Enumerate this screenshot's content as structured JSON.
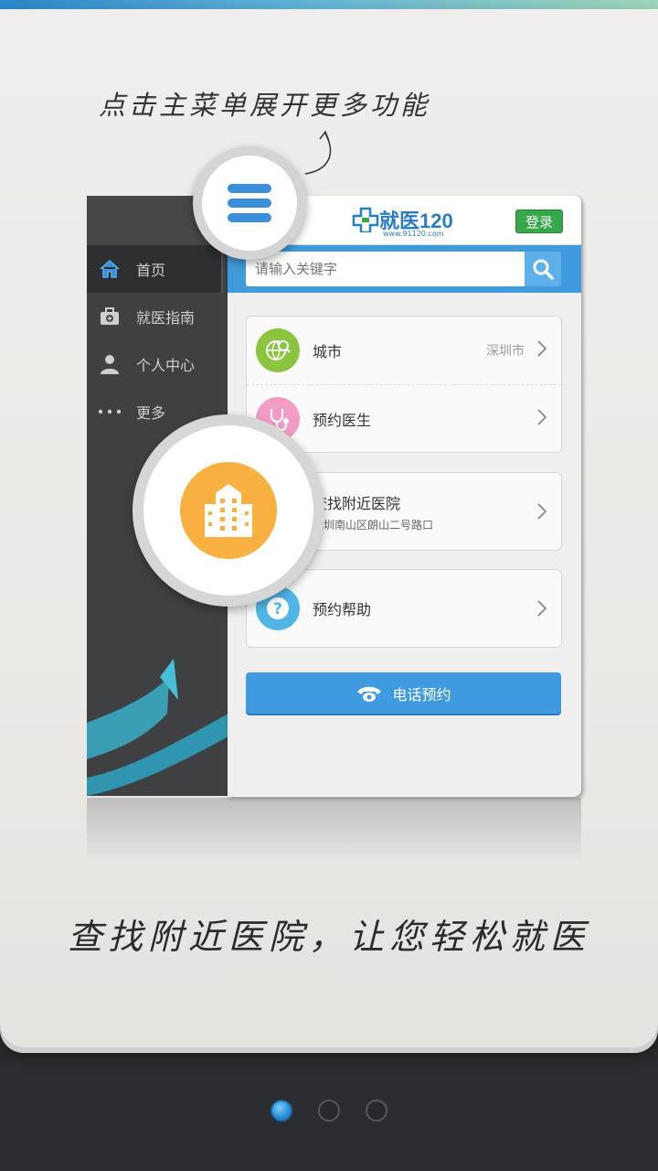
{
  "hint_text": "点击主菜单展开更多功能",
  "sidebar": {
    "items": [
      {
        "label": "首页",
        "icon": "home-icon"
      },
      {
        "label": "就医指南",
        "icon": "medical-kit-icon"
      },
      {
        "label": "个人中心",
        "icon": "user-icon"
      },
      {
        "label": "更多",
        "icon": "more-dots-icon"
      }
    ]
  },
  "header": {
    "logo_text": "就医120",
    "logo_sub": "www.91120.com",
    "login_label": "登录"
  },
  "search": {
    "placeholder": "请输入关键字"
  },
  "menu": {
    "city_label": "城市",
    "city_value": "深圳市",
    "doctor_label": "预约医生",
    "hospital_label": "查找附近医院",
    "hospital_address": "深圳南山区朗山二号路口",
    "help_label": "预约帮助"
  },
  "call_button_label": "电话预约",
  "caption": "查找附近医院，让您轻松就医",
  "pager": {
    "total": 3,
    "current": 1
  },
  "colors": {
    "accent_blue": "#409bdc",
    "login_green": "#37a84a",
    "hospital_orange": "#f8b040",
    "city_green": "#8bc53f",
    "doctor_pink": "#f29cc4",
    "help_blue": "#4fb6e6"
  }
}
